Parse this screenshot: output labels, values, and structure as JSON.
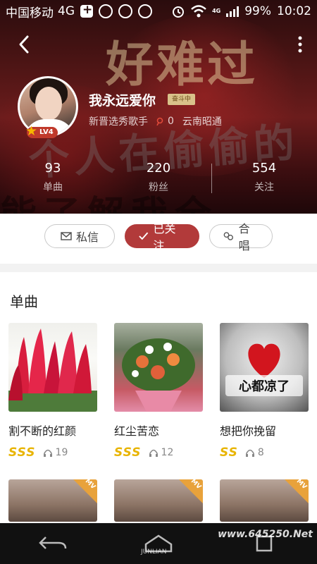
{
  "status_bar": {
    "carrier": "中国移动",
    "network": "4G",
    "signal_label": "4G",
    "battery": "99%",
    "time": "10:02"
  },
  "profile": {
    "name": "我永远爱你",
    "fight_badge": "奋斗中",
    "title": "新晋选秀歌手",
    "count": "0",
    "location": "云南昭通",
    "level": "LV4"
  },
  "stats": [
    {
      "value": "93",
      "label": "单曲"
    },
    {
      "value": "220",
      "label": "粉丝"
    },
    {
      "value": "554",
      "label": "关注"
    }
  ],
  "actions": {
    "message": "私信",
    "followed": "已关注",
    "duet": "合唱"
  },
  "songs_section": {
    "title": "单曲",
    "items": [
      {
        "title": "割不断的红颜",
        "grade": "SSS",
        "plays": "19",
        "thumb": "red-flowers"
      },
      {
        "title": "红尘苦恋",
        "grade": "SSS",
        "plays": "12",
        "thumb": "bouquet"
      },
      {
        "title": "想把你挽留",
        "grade": "SS",
        "plays": "8",
        "thumb": "heart-ice"
      }
    ],
    "mv_items": [
      {
        "tag": "MV"
      },
      {
        "tag": "MV"
      },
      {
        "tag": "MV"
      }
    ]
  },
  "hero_text": {
    "line1": "好难过",
    "line2": "个人在偷偷的",
    "line3": "能了解我全"
  },
  "watermark": {
    "site": "www.645250.Net",
    "brand": "JUNLIAN"
  },
  "colors": {
    "accent": "#b23a3a",
    "grade_gold": "#e8b400",
    "mv_orange": "#e8a23b"
  }
}
